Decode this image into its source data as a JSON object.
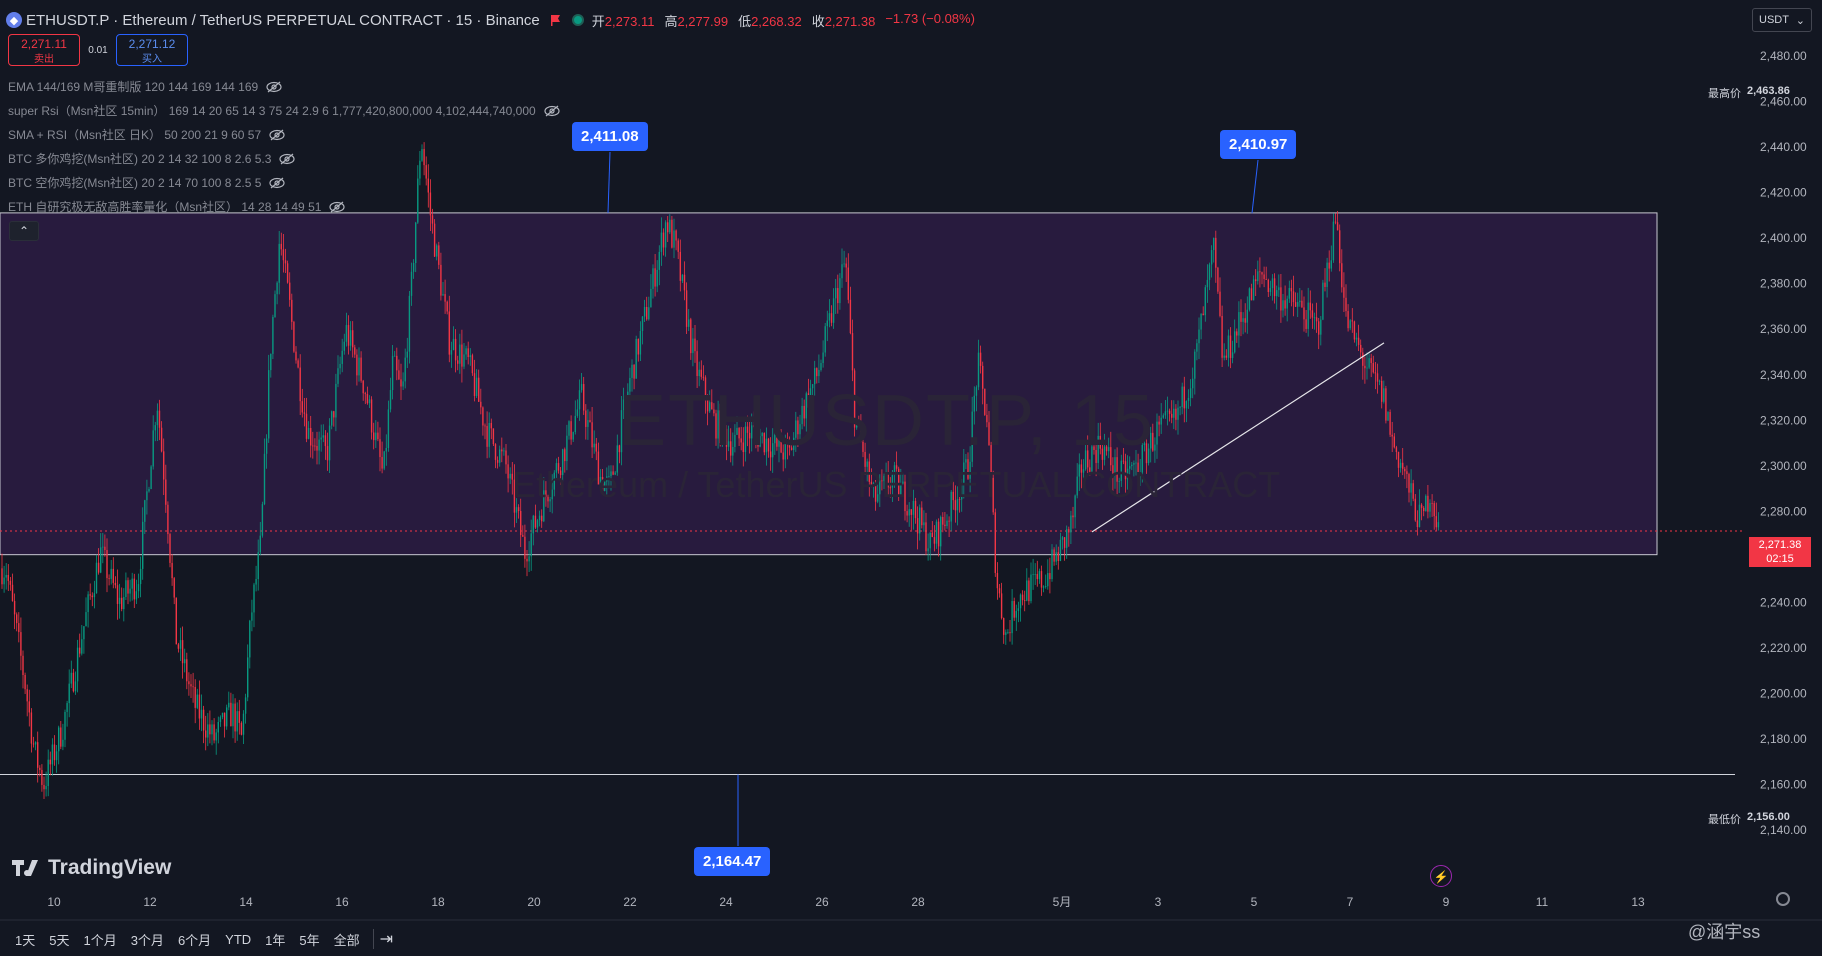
{
  "header": {
    "symbol": "ETHUSDT.P · Ethereum / TetherUS PERPETUAL CONTRACT · 15 · Binance",
    "ohlc": [
      {
        "k": "开",
        "v": "2,273.11"
      },
      {
        "k": "高",
        "v": "2,277.99"
      },
      {
        "k": "低",
        "v": "2,268.32"
      },
      {
        "k": "收",
        "v": "2,271.38"
      }
    ],
    "change": "−1.73 (−0.08%)"
  },
  "trade": {
    "sell_price": "2,271.11",
    "sell_label": "卖出",
    "spread": "0.01",
    "buy_price": "2,271.12",
    "buy_label": "买入"
  },
  "indicators": [
    "EMA 144/169 M哥重制版 120 144 169 144 169",
    "super Rsi（Msn社区 15min） 169 14 20 65 14 3 75 24 2.9 6 1,777,420,800,000 4,102,444,740,000",
    "SMA + RSI（Msn社区 日K） 50 200 21 9 60 57",
    "BTC 多你鸡挖(Msn社区) 20 2 14 32 100 8 2.6 5.3",
    "BTC 空你鸡挖(Msn社区) 20 2 14 70 100 8 2.5 5",
    "ETH 自研究极无敌高胜率量化（Msn社区） 14 28 14 49 51"
  ],
  "currency": "USDT",
  "watermark": {
    "symbol": "ETHUSDT.P, 15",
    "desc": "Ethereum / TetherUS PERPETUAL CONTRACT"
  },
  "callouts": {
    "a": "2,411.08",
    "b": "2,410.97",
    "c": "2,164.47"
  },
  "price_tags": {
    "high_label": "最高价",
    "high": "2,463.86",
    "low_label": "最低价",
    "low": "2,156.00",
    "current": "2,271.38",
    "countdown": "02:15"
  },
  "brand": "TradingView",
  "timeframes": [
    "1天",
    "5天",
    "1个月",
    "3个月",
    "6个月",
    "YTD",
    "1年",
    "5年",
    "全部"
  ],
  "user_watermark": "@涵宇ss",
  "colors": {
    "bg": "#131722",
    "up": "#089981",
    "down": "#f23645",
    "accent": "#2962ff",
    "box": "#8e44ad"
  },
  "chart_data": {
    "type": "candlestick",
    "y_ticks": [
      "2,480.00",
      "2,460.00",
      "2,440.00",
      "2,420.00",
      "2,400.00",
      "2,380.00",
      "2,360.00",
      "2,340.00",
      "2,320.00",
      "2,300.00",
      "2,280.00",
      "2,260.00",
      "2,240.00",
      "2,220.00",
      "2,200.00",
      "2,180.00",
      "2,160.00",
      "2,140.00"
    ],
    "y_values": [
      2480,
      2460,
      2440,
      2420,
      2400,
      2380,
      2360,
      2340,
      2320,
      2300,
      2280,
      2260,
      2240,
      2220,
      2200,
      2180,
      2160,
      2140
    ],
    "x_ticks": [
      "10",
      "12",
      "14",
      "16",
      "18",
      "20",
      "22",
      "24",
      "26",
      "28",
      "5月",
      "3",
      "5",
      "7",
      "9",
      "11",
      "13"
    ],
    "ylim": [
      2130,
      2487
    ],
    "range_box": {
      "top": 2411.08,
      "bottom": 2261
    },
    "support_line": 2164.47,
    "trendline": {
      "from": 2271,
      "to": 2354
    },
    "price_path": [
      [
        0,
        2255
      ],
      [
        2,
        2205
      ],
      [
        3,
        2175
      ],
      [
        4,
        2160
      ],
      [
        6,
        2185
      ],
      [
        8,
        2225
      ],
      [
        10,
        2262
      ],
      [
        12,
        2240
      ],
      [
        14,
        2250
      ],
      [
        16,
        2330
      ],
      [
        17,
        2285
      ],
      [
        18,
        2225
      ],
      [
        20,
        2195
      ],
      [
        22,
        2180
      ],
      [
        24,
        2192
      ],
      [
        25,
        2180
      ],
      [
        26,
        2235
      ],
      [
        27,
        2265
      ],
      [
        28,
        2350
      ],
      [
        29,
        2400
      ],
      [
        30,
        2372
      ],
      [
        31,
        2340
      ],
      [
        32,
        2315
      ],
      [
        34,
        2305
      ],
      [
        36,
        2360
      ],
      [
        38,
        2335
      ],
      [
        40,
        2295
      ],
      [
        41,
        2345
      ],
      [
        42,
        2330
      ],
      [
        43,
        2380
      ],
      [
        44,
        2445
      ],
      [
        45,
        2410
      ],
      [
        47,
        2355
      ],
      [
        49,
        2345
      ],
      [
        51,
        2315
      ],
      [
        53,
        2300
      ],
      [
        55,
        2262
      ],
      [
        57,
        2285
      ],
      [
        59,
        2305
      ],
      [
        61,
        2330
      ],
      [
        63,
        2295
      ],
      [
        64,
        2290
      ],
      [
        66,
        2335
      ],
      [
        68,
        2370
      ],
      [
        70,
        2408
      ],
      [
        71,
        2395
      ],
      [
        72,
        2370
      ],
      [
        73,
        2345
      ],
      [
        75,
        2320
      ],
      [
        77,
        2310
      ],
      [
        79,
        2315
      ],
      [
        81,
        2310
      ],
      [
        83,
        2305
      ],
      [
        84,
        2320
      ],
      [
        86,
        2340
      ],
      [
        88,
        2375
      ],
      [
        89,
        2390
      ],
      [
        90,
        2320
      ],
      [
        92,
        2285
      ],
      [
        94,
        2295
      ],
      [
        96,
        2282
      ],
      [
        98,
        2265
      ],
      [
        100,
        2280
      ],
      [
        102,
        2300
      ],
      [
        103,
        2345
      ],
      [
        104,
        2320
      ],
      [
        105,
        2250
      ],
      [
        106,
        2225
      ],
      [
        107,
        2240
      ],
      [
        108,
        2245
      ],
      [
        110,
        2250
      ],
      [
        112,
        2265
      ],
      [
        113,
        2275
      ],
      [
        114,
        2300
      ],
      [
        116,
        2310
      ],
      [
        118,
        2295
      ],
      [
        120,
        2300
      ],
      [
        122,
        2315
      ],
      [
        124,
        2320
      ],
      [
        126,
        2345
      ],
      [
        127,
        2370
      ],
      [
        128,
        2395
      ],
      [
        129,
        2345
      ],
      [
        131,
        2365
      ],
      [
        133,
        2385
      ],
      [
        135,
        2375
      ],
      [
        137,
        2370
      ],
      [
        139,
        2360
      ],
      [
        140,
        2385
      ],
      [
        141,
        2410
      ],
      [
        142,
        2365
      ],
      [
        144,
        2345
      ],
      [
        146,
        2330
      ],
      [
        147,
        2310
      ],
      [
        148,
        2300
      ],
      [
        149,
        2285
      ],
      [
        150,
        2275
      ],
      [
        151,
        2290
      ],
      [
        152,
        2268
      ]
    ]
  }
}
